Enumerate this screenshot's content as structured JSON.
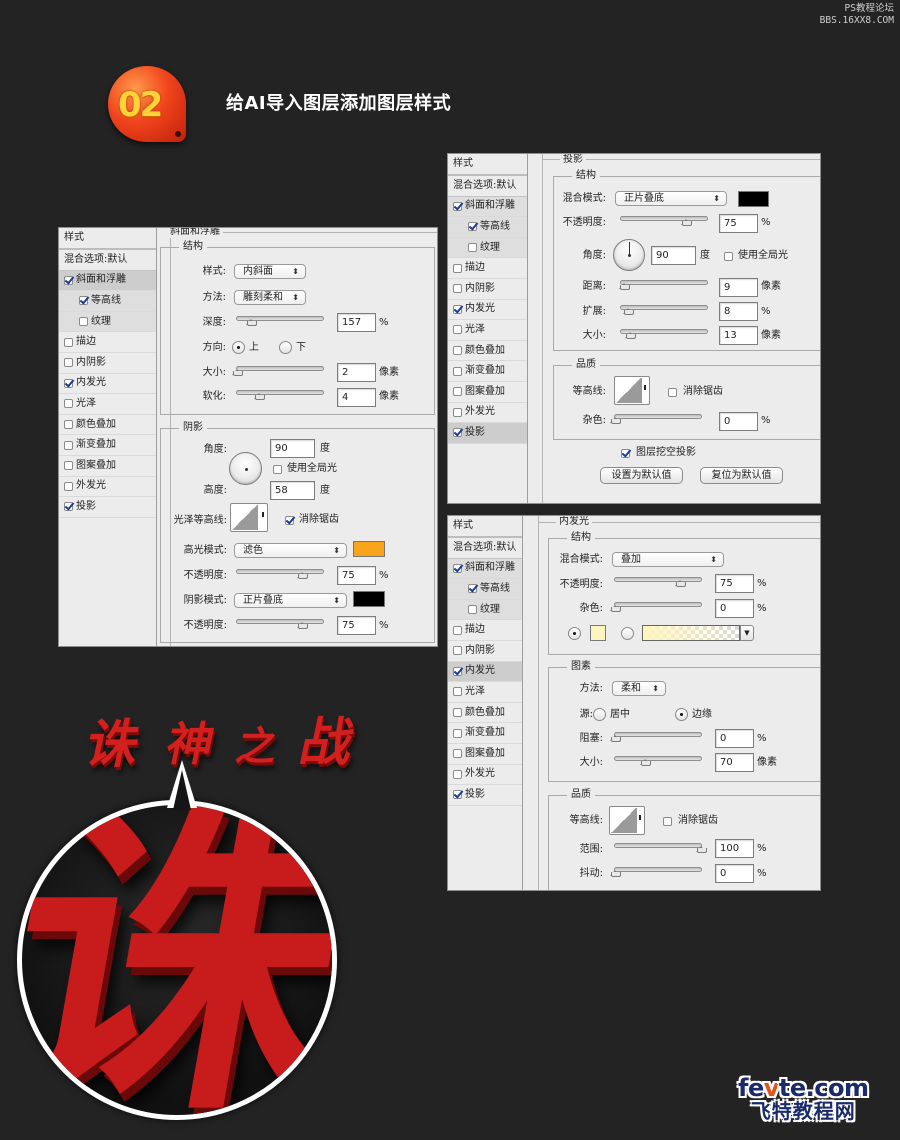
{
  "watermark": {
    "line1": "PS教程论坛",
    "line2": "BBS.16XX8.COM"
  },
  "step": {
    "number": "02",
    "title": "给AI导入图层添加图层样式"
  },
  "sidebar_common": {
    "header": "样式",
    "blend": "混合选项:默认",
    "items": [
      "斜面和浮雕",
      "等高线",
      "纹理",
      "描边",
      "内阴影",
      "内发光",
      "光泽",
      "颜色叠加",
      "渐变叠加",
      "图案叠加",
      "外发光",
      "投影"
    ]
  },
  "panel_bevel": {
    "title": "斜面和浮雕",
    "checked": [
      true,
      true,
      false,
      false,
      false,
      true,
      false,
      false,
      false,
      false,
      false,
      true
    ],
    "selected_index": 0,
    "structure": {
      "legend": "结构",
      "style_label": "样式:",
      "style_value": "内斜面",
      "technique_label": "方法:",
      "technique_value": "雕刻柔和",
      "depth_label": "深度:",
      "depth_value": "157",
      "depth_unit": "%",
      "depth_pct": 0.157,
      "direction_label": "方向:",
      "dir_up": "上",
      "dir_down": "下",
      "dir_selected": "上",
      "size_label": "大小:",
      "size_value": "2",
      "size_unit": "像素",
      "size_pct": 0.0,
      "soften_label": "软化:",
      "soften_value": "4",
      "soften_unit": "像素",
      "soften_pct": 0.25
    },
    "shading": {
      "legend": "阴影",
      "angle_label": "角度:",
      "angle_value": "90",
      "angle_unit": "度",
      "global_light": "使用全局光",
      "global_light_checked": false,
      "altitude_label": "高度:",
      "altitude_value": "58",
      "altitude_unit": "度",
      "gloss_label": "光泽等高线:",
      "antialias": "消除锯齿",
      "antialias_checked": true,
      "highlight_label": "高光模式:",
      "highlight_mode": "滤色",
      "highlight_color": "#f8a51b",
      "hl_opacity_label": "不透明度:",
      "hl_opacity_value": "75",
      "hl_opacity_unit": "%",
      "hl_opacity_pct": 0.75,
      "shadow_label": "阴影模式:",
      "shadow_mode": "正片叠底",
      "shadow_color": "#000000",
      "sh_opacity_label": "不透明度:",
      "sh_opacity_value": "75",
      "sh_opacity_unit": "%",
      "sh_opacity_pct": 0.75
    }
  },
  "panel_drop": {
    "title": "投影",
    "checked": [
      true,
      true,
      false,
      false,
      false,
      true,
      false,
      false,
      false,
      false,
      false,
      true
    ],
    "selected_index": 11,
    "structure": {
      "legend": "结构",
      "blend_label": "混合模式:",
      "blend_value": "正片叠底",
      "color": "#000000",
      "opacity_label": "不透明度:",
      "opacity_value": "75",
      "opacity_unit": "%",
      "opacity_pct": 0.75,
      "angle_label": "角度:",
      "angle_value": "90",
      "angle_unit": "度",
      "global_light": "使用全局光",
      "global_light_checked": false,
      "distance_label": "距离:",
      "distance_value": "9",
      "distance_unit": "像素",
      "distance_pct": 0.03,
      "spread_label": "扩展:",
      "spread_value": "8",
      "spread_unit": "%",
      "spread_pct": 0.08,
      "size_label": "大小:",
      "size_value": "13",
      "size_unit": "像素",
      "size_pct": 0.1
    },
    "quality": {
      "legend": "品质",
      "contour_label": "等高线:",
      "antialias": "消除锯齿",
      "antialias_checked": false,
      "noise_label": "杂色:",
      "noise_value": "0",
      "noise_unit": "%",
      "noise_pct": 0.0
    },
    "knockout": "图层挖空投影",
    "knockout_checked": true,
    "btn_default": "设置为默认值",
    "btn_reset": "复位为默认值"
  },
  "panel_inner": {
    "title": "内发光",
    "checked": [
      true,
      true,
      false,
      false,
      false,
      true,
      false,
      false,
      false,
      false,
      false,
      true
    ],
    "selected_index": 5,
    "structure": {
      "legend": "结构",
      "blend_label": "混合模式:",
      "blend_value": "叠加",
      "opacity_label": "不透明度:",
      "opacity_value": "75",
      "opacity_unit": "%",
      "opacity_pct": 0.75,
      "noise_label": "杂色:",
      "noise_value": "0",
      "noise_unit": "%",
      "noise_pct": 0.0,
      "color": "#fdf4c0",
      "fill_mode": "color"
    },
    "elements": {
      "legend": "图素",
      "technique_label": "方法:",
      "technique_value": "柔和",
      "source_label": "源:",
      "src_center": "居中",
      "src_edge": "边缘",
      "src_selected": "边缘",
      "choke_label": "阻塞:",
      "choke_value": "0",
      "choke_unit": "%",
      "choke_pct": 0.0,
      "size_label": "大小:",
      "size_value": "70",
      "size_unit": "像素",
      "size_pct": 0.35
    },
    "quality": {
      "legend": "品质",
      "contour_label": "等高线:",
      "antialias": "消除锯齿",
      "antialias_checked": false,
      "range_label": "范围:",
      "range_value": "100",
      "range_unit": "%",
      "range_pct": 1.0,
      "jitter_label": "抖动:",
      "jitter_value": "0",
      "jitter_unit": "%",
      "jitter_pct": 0.0
    }
  },
  "artwork": {
    "title_chars": [
      "诛",
      "神",
      "之",
      "战"
    ],
    "zoom_char": "诛"
  },
  "logo": {
    "line1_a": "fe",
    "line1_v": "v",
    "line1_b": "te.com",
    "line2": "飞特教程网"
  }
}
